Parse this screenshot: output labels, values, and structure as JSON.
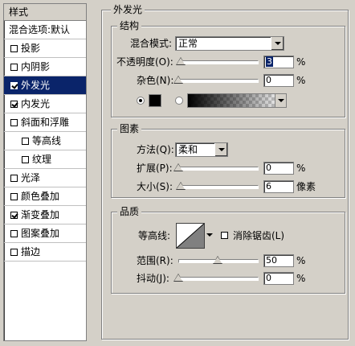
{
  "left_panel": {
    "header": "样式",
    "items": [
      {
        "label": "混合选项:默认",
        "checkbox": false,
        "checked": false,
        "indent": false,
        "selected": false
      },
      {
        "label": "投影",
        "checkbox": true,
        "checked": false,
        "indent": false,
        "selected": false
      },
      {
        "label": "内阴影",
        "checkbox": true,
        "checked": false,
        "indent": false,
        "selected": false
      },
      {
        "label": "外发光",
        "checkbox": true,
        "checked": true,
        "indent": false,
        "selected": true
      },
      {
        "label": "内发光",
        "checkbox": true,
        "checked": true,
        "indent": false,
        "selected": false
      },
      {
        "label": "斜面和浮雕",
        "checkbox": true,
        "checked": false,
        "indent": false,
        "selected": false
      },
      {
        "label": "等高线",
        "checkbox": true,
        "checked": false,
        "indent": true,
        "selected": false
      },
      {
        "label": "纹理",
        "checkbox": true,
        "checked": false,
        "indent": true,
        "selected": false
      },
      {
        "label": "光泽",
        "checkbox": true,
        "checked": false,
        "indent": false,
        "selected": false
      },
      {
        "label": "颜色叠加",
        "checkbox": true,
        "checked": false,
        "indent": false,
        "selected": false
      },
      {
        "label": "渐变叠加",
        "checkbox": true,
        "checked": true,
        "indent": false,
        "selected": false
      },
      {
        "label": "图案叠加",
        "checkbox": true,
        "checked": false,
        "indent": false,
        "selected": false
      },
      {
        "label": "描边",
        "checkbox": true,
        "checked": false,
        "indent": false,
        "selected": false
      }
    ]
  },
  "outer_glow": {
    "title": "外发光",
    "structure": {
      "title": "结构",
      "blend_mode_label": "混合模式:",
      "blend_mode_value": "正常",
      "opacity_label": "不透明度(O):",
      "opacity_value": "3",
      "opacity_unit": "%",
      "opacity_fraction": 0.03,
      "noise_label": "杂色(N):",
      "noise_value": "0",
      "noise_unit": "%",
      "noise_fraction": 0.0,
      "color_mode": "solid",
      "solid_color": "#000000"
    },
    "elements": {
      "title": "图素",
      "method_label": "方法(Q):",
      "method_value": "柔和",
      "spread_label": "扩展(P):",
      "spread_value": "0",
      "spread_unit": "%",
      "spread_fraction": 0.0,
      "size_label": "大小(S):",
      "size_value": "6",
      "size_unit": "像素",
      "size_fraction": 0.03
    },
    "quality": {
      "title": "品质",
      "contour_label": "等高线:",
      "antialias_label": "消除锯齿(L)",
      "antialias_checked": false,
      "range_label": "范围(R):",
      "range_value": "50",
      "range_unit": "%",
      "range_fraction": 0.5,
      "jitter_label": "抖动(J):",
      "jitter_value": "0",
      "jitter_unit": "%",
      "jitter_fraction": 0.0
    }
  },
  "colors": {
    "selection": "#0a246a",
    "background": "#d4d0c8"
  }
}
